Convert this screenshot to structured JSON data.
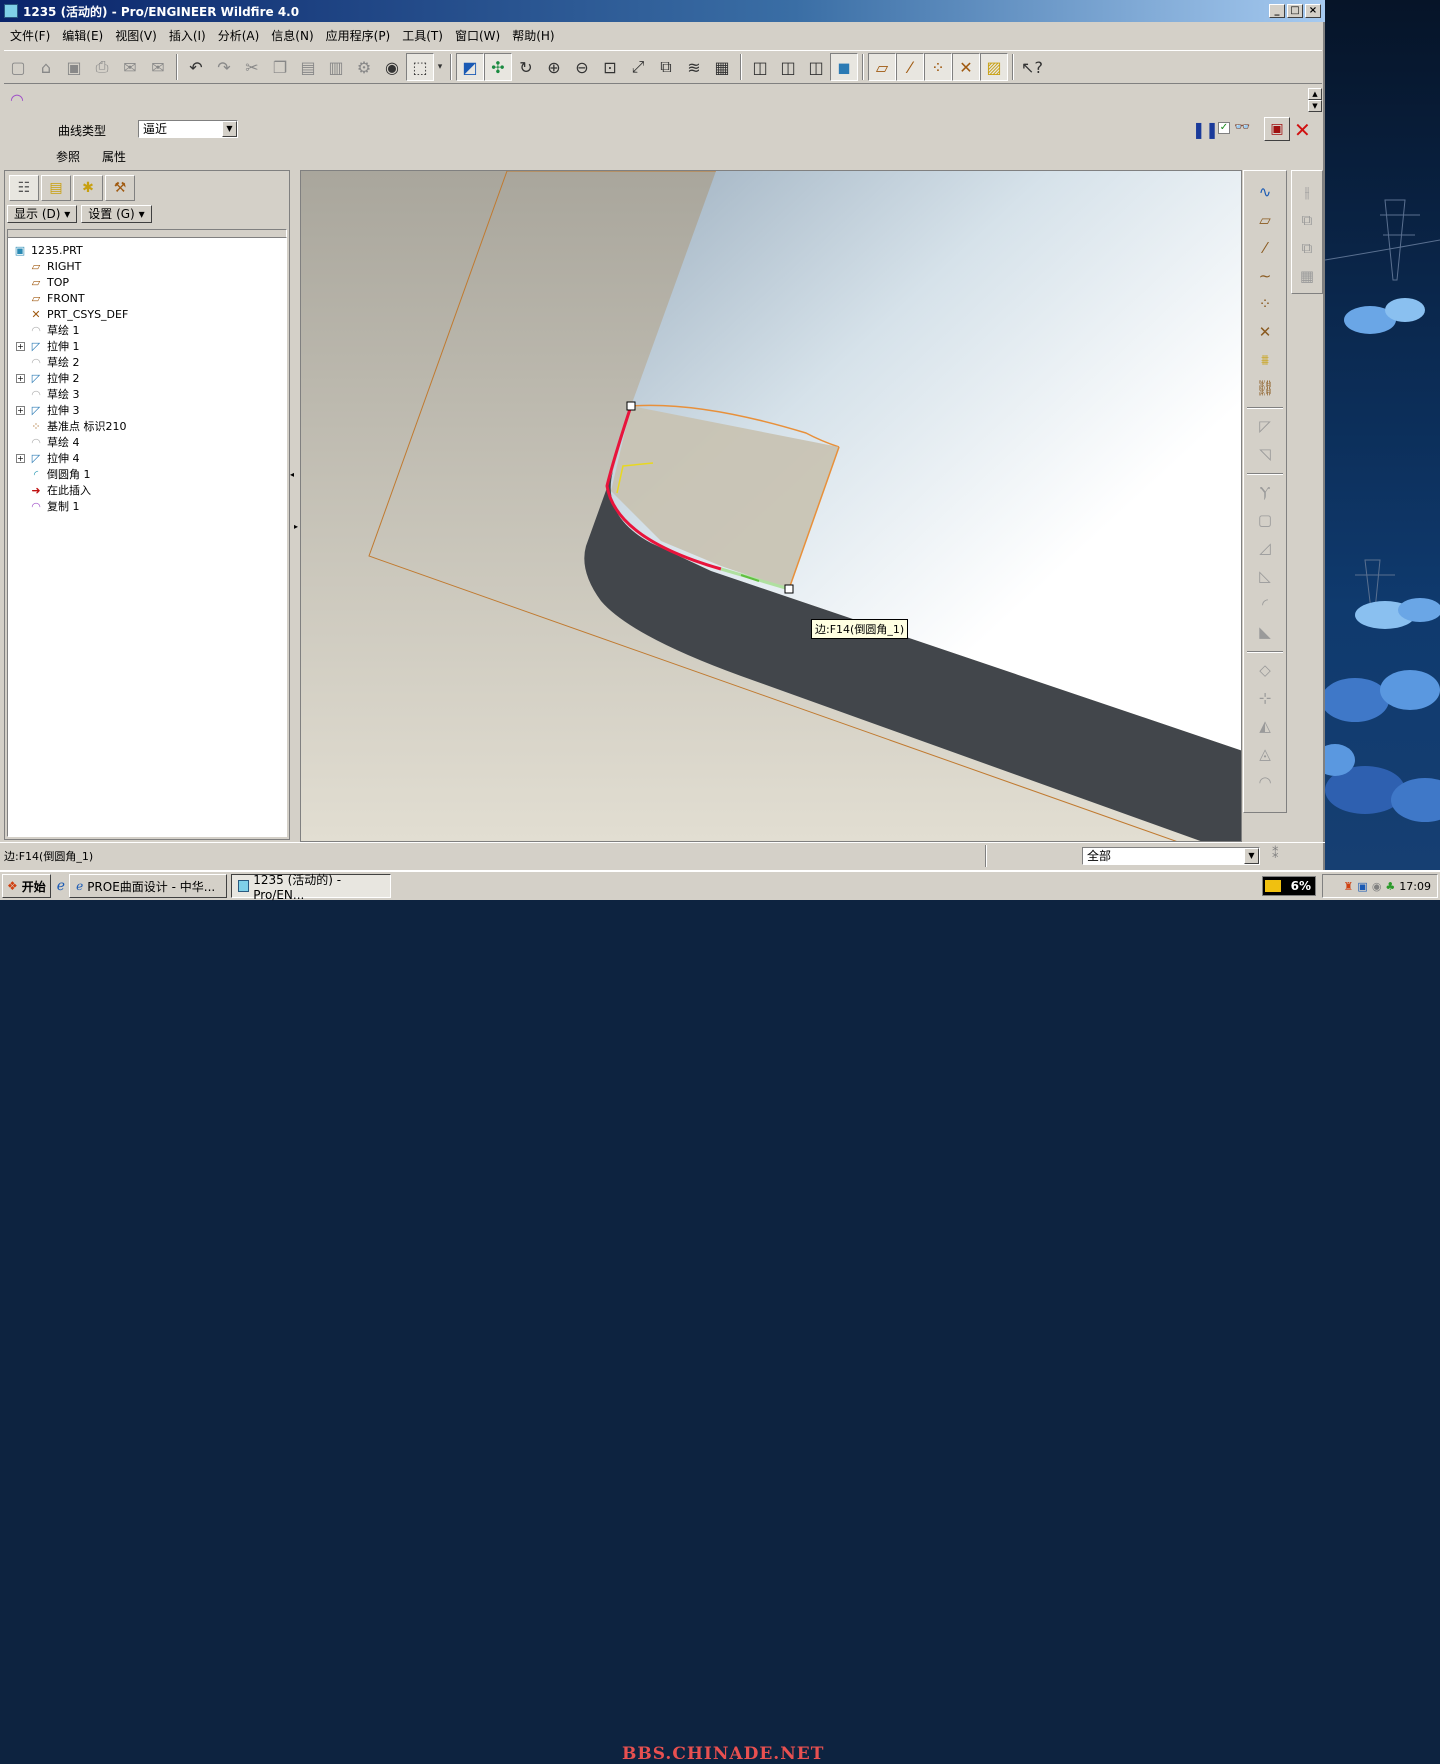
{
  "window": {
    "title": "1235 (活动的) - Pro/ENGINEER Wildfire 4.0",
    "min_label": "_",
    "max_label": "□",
    "close_label": "×"
  },
  "menu": [
    "文件(F)",
    "编辑(E)",
    "视图(V)",
    "插入(I)",
    "分析(A)",
    "信息(N)",
    "应用程序(P)",
    "工具(T)",
    "窗口(W)",
    "帮助(H)"
  ],
  "dashboard": {
    "curve_type_label": "曲线类型",
    "curve_type_value": "逼近",
    "tab_references": "参照",
    "tab_properties": "属性"
  },
  "navigator": {
    "show_btn": "显示 (D)",
    "settings_btn": "设置 (G)"
  },
  "tree": [
    {
      "label": "1235.PRT",
      "icon": "part-icon",
      "expander": false,
      "indent": 0
    },
    {
      "label": "RIGHT",
      "icon": "datum-plane-icon",
      "expander": false,
      "indent": 1
    },
    {
      "label": "TOP",
      "icon": "datum-plane-icon",
      "expander": false,
      "indent": 1
    },
    {
      "label": "FRONT",
      "icon": "datum-plane-icon",
      "expander": false,
      "indent": 1
    },
    {
      "label": "PRT_CSYS_DEF",
      "icon": "csys-icon",
      "expander": false,
      "indent": 1
    },
    {
      "label": "草绘 1",
      "icon": "sketch-icon",
      "expander": false,
      "indent": 1
    },
    {
      "label": "拉伸 1",
      "icon": "extrude-icon",
      "expander": true,
      "indent": 1
    },
    {
      "label": "草绘 2",
      "icon": "sketch-icon",
      "expander": false,
      "indent": 1
    },
    {
      "label": "拉伸 2",
      "icon": "extrude-icon",
      "expander": true,
      "indent": 1
    },
    {
      "label": "草绘 3",
      "icon": "sketch-icon",
      "expander": false,
      "indent": 1
    },
    {
      "label": "拉伸 3",
      "icon": "extrude-icon",
      "expander": true,
      "indent": 1
    },
    {
      "label": "基准点 标识210",
      "icon": "datum-point-icon",
      "expander": false,
      "indent": 1
    },
    {
      "label": "草绘 4",
      "icon": "sketch-icon",
      "expander": false,
      "indent": 1
    },
    {
      "label": "拉伸 4",
      "icon": "extrude-icon",
      "expander": true,
      "indent": 1
    },
    {
      "label": "倒圆角 1",
      "icon": "round-icon",
      "expander": false,
      "indent": 1
    },
    {
      "label": "在此插入",
      "icon": "insert-arrow-icon",
      "expander": false,
      "indent": 1
    },
    {
      "label": "复制 1",
      "icon": "copy-surface-icon",
      "expander": false,
      "indent": 1
    }
  ],
  "viewport": {
    "tooltip": "边:F14(倒圆角_1)"
  },
  "status": {
    "message": "边:F14(倒圆角_1)",
    "filter_value": "全部"
  },
  "taskbar": {
    "start_label": "开始",
    "tasks": [
      "PROE曲面设计 - 中华...",
      "1235 (活动的) - Pro/EN..."
    ],
    "watermark": "BBS.CHINADE.NET",
    "cpu": "6%",
    "clock": "17:09"
  },
  "colors": {
    "title_start": "#0a246a",
    "edge_highlight": "#e8143c",
    "model_dark": "#42464b",
    "watermark": "#e85050"
  }
}
